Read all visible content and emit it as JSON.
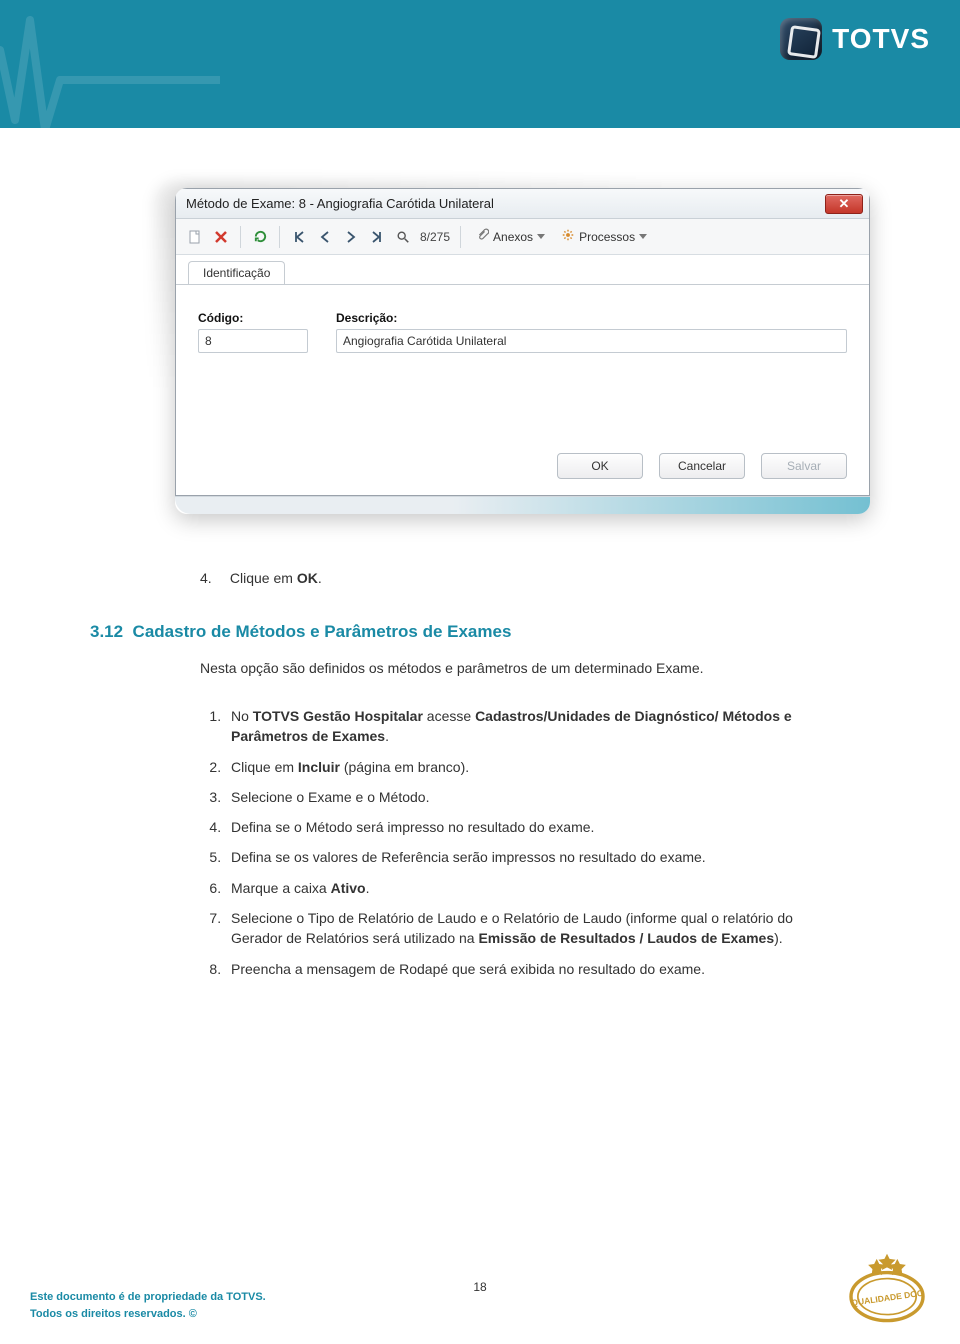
{
  "brand": {
    "name": "TOTVS"
  },
  "screenshot": {
    "window_title": "Método de Exame: 8 - Angiografia Carótida Unilateral",
    "toolbar": {
      "record_pos": "8/275",
      "anexos_label": "Anexos",
      "processos_label": "Processos"
    },
    "tab_label": "Identificação",
    "form": {
      "codigo_label": "Código:",
      "codigo_value": "8",
      "descricao_label": "Descrição:",
      "descricao_value": "Angiografia Carótida Unilateral"
    },
    "buttons": {
      "ok": "OK",
      "cancelar": "Cancelar",
      "salvar": "Salvar"
    }
  },
  "doc": {
    "preceding_step": {
      "num": "4.",
      "text_prefix": "Clique em ",
      "text_bold": "OK",
      "text_suffix": "."
    },
    "section_num": "3.12",
    "section_title": "Cadastro de Métodos e Parâmetros de Exames",
    "intro": "Nesta opção são definidos os métodos e parâmetros de um determinado Exame.",
    "steps": [
      "No TOTVS Gestão Hospitalar acesse Cadastros/Unidades de Diagnóstico/ Métodos e Parâmetros de Exames.",
      "Clique em Incluir (página em branco).",
      "Selecione o Exame e o Método.",
      "Defina se o Método será impresso no resultado do exame.",
      "Defina se os valores de Referência serão impressos no resultado do exame.",
      "Marque a caixa Ativo.",
      "Selecione o Tipo de Relatório de Laudo e o Relatório de Laudo (informe qual o relatório do Gerador de Relatórios será utilizado na Emissão de Resultados / Laudos de Exames).",
      "Preencha a mensagem de Rodapé que será exibida no resultado do exame."
    ]
  },
  "footer": {
    "line1": "Este documento é de propriedade da TOTVS.",
    "line2": "Todos os direitos reservados. ©",
    "page_number": "18",
    "stamp_text": "QUALIDADE DOC"
  }
}
